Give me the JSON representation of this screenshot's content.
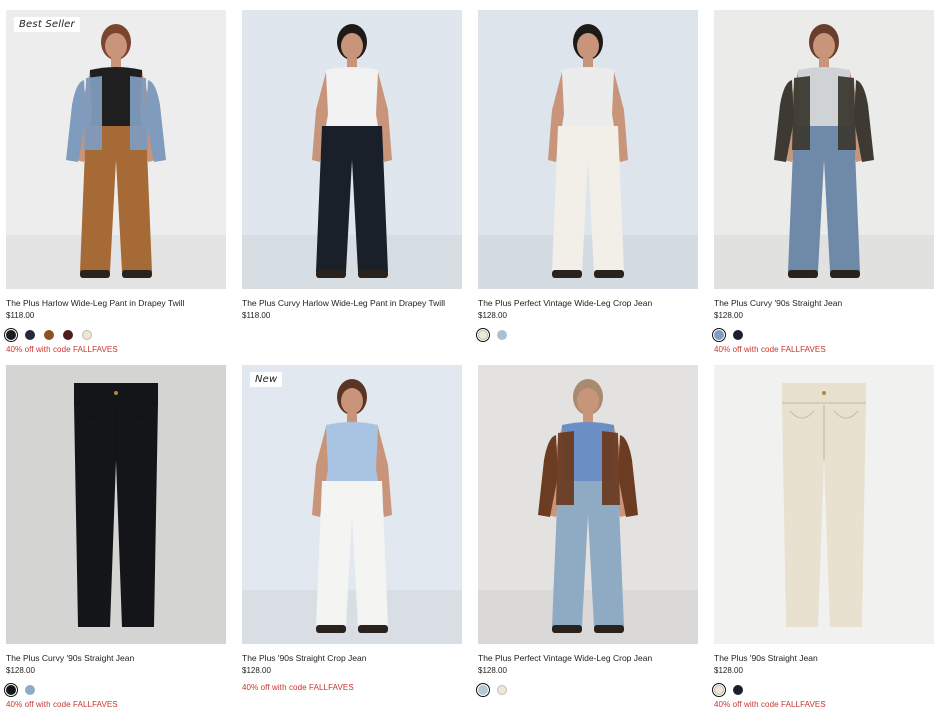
{
  "products": [
    {
      "badge": "Best Seller",
      "title": "The Plus Harlow Wide-Leg Pant in Drapey Twill",
      "price": "$118.00",
      "swatches": [
        "#1b1b22",
        "#242a3d",
        "#8a5326",
        "#4a1f1c",
        "#efe6d2"
      ],
      "promo": "40% off with code FALLFAVES",
      "bg": "#ededed",
      "figure": {
        "top": "#1f1f1f",
        "pants": "#a66a37",
        "jacket": "#7f9bbd",
        "hair": "#7a4430"
      }
    },
    {
      "badge": "",
      "title": "The Plus Curvy Harlow Wide-Leg Pant in Drapey Twill",
      "price": "$118.00",
      "swatches": [],
      "promo": "",
      "bg": "#dfe6ed",
      "figure": {
        "top": "#f2f2f2",
        "pants": "#1a2029",
        "jacket": "",
        "hair": "#1e1a18"
      }
    },
    {
      "badge": "",
      "title": "The Plus Perfect Vintage Wide-Leg Crop Jean",
      "price": "$128.00",
      "swatches": [
        "#efe8d5",
        "#a9c0d2"
      ],
      "promo": "",
      "bg": "#dde4ec",
      "figure": {
        "top": "#ececec",
        "pants": "#f1efe8",
        "jacket": "",
        "hair": "#1e1a18"
      }
    },
    {
      "badge": "",
      "title": "The Plus Curvy '90s Straight Jean",
      "price": "$128.00",
      "swatches": [
        "#7f9dc0",
        "#1b1f29"
      ],
      "promo": "40% off with code FALLFAVES",
      "bg": "#ebebea",
      "figure": {
        "top": "#cfd3d6",
        "pants": "#6f8aa8",
        "jacket": "#3c3a33",
        "hair": "#6a3e2c"
      }
    },
    {
      "badge": "",
      "title": "The Plus Curvy '90s Straight Jean",
      "price": "$128.00",
      "swatches": [
        "#15161a",
        "#90abc8"
      ],
      "promo": "40% off with code FALLFAVES",
      "bg": "#d4d4d2",
      "figure": {
        "top": "",
        "pants": "#141518",
        "jacket": "",
        "hair": ""
      }
    },
    {
      "badge": "New",
      "title": "The Plus '90s Straight Crop Jean",
      "price": "$128.00",
      "swatches": [],
      "promo": "40% off with code FALLFAVES",
      "bg": "#e2e8ef",
      "figure": {
        "top": "#a9c3e3",
        "pants": "#f4f4f2",
        "jacket": "",
        "hair": "#5a3526"
      }
    },
    {
      "badge": "",
      "title": "The Plus Perfect Vintage Wide-Leg Crop Jean",
      "price": "$128.00",
      "swatches": [
        "#b3c9d8",
        "#efe6d6"
      ],
      "promo": "",
      "bg": "#e4e2e0",
      "figure": {
        "top": "#6b8fc4",
        "pants": "#8fabc4",
        "jacket": "#6b3c22",
        "hair": "#a88a70"
      }
    },
    {
      "badge": "",
      "title": "The Plus '90s Straight Jean",
      "price": "$128.00",
      "swatches": [
        "#efe7d3",
        "#1b1f2c"
      ],
      "promo": "40% off with code FALLFAVES",
      "bg": "#f1f1f0",
      "figure": {
        "top": "",
        "pants": "#e9e1cf",
        "jacket": "",
        "hair": ""
      }
    }
  ]
}
